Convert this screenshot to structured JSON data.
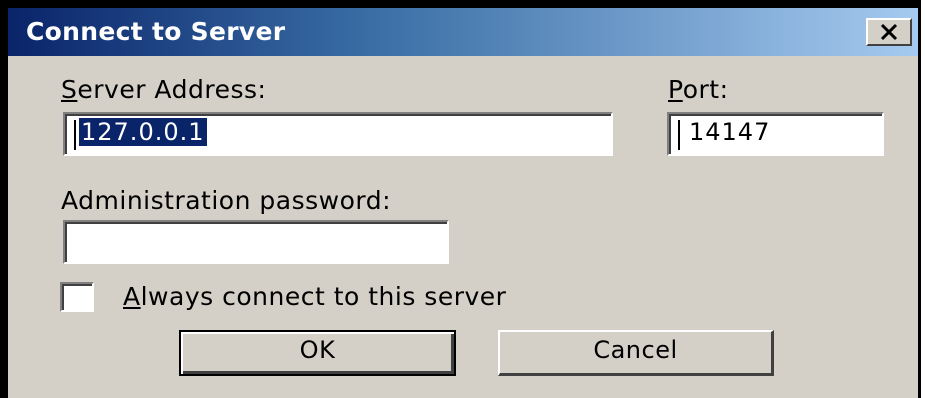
{
  "window": {
    "title": "Connect to Server",
    "close_glyph": "close-icon"
  },
  "server_address": {
    "label_hotkey": "S",
    "label_rest": "erver Address:",
    "value": "127.0.0.1"
  },
  "port": {
    "label_hotkey": "P",
    "label_rest": "ort:",
    "value": "14147"
  },
  "admin_password": {
    "label": "Administration password:",
    "value": ""
  },
  "always_connect": {
    "label_hotkey": "A",
    "label_rest": "lways connect to this server",
    "checked": false
  },
  "buttons": {
    "ok_label": "OK",
    "cancel_label": "Cancel"
  },
  "colors": {
    "titlebar_start": "#0a246a",
    "titlebar_end": "#a6caf0",
    "dialog_bg": "#d4d0c8",
    "selection": "#0a246a"
  }
}
